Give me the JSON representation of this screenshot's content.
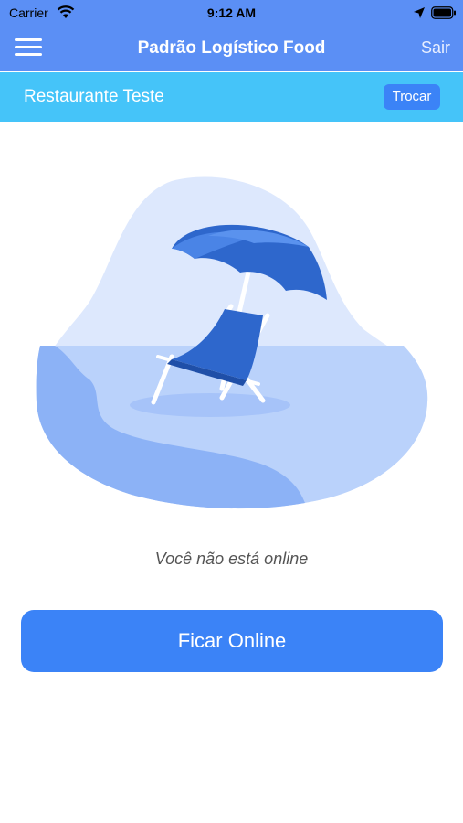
{
  "status_bar": {
    "carrier": "Carrier",
    "time": "9:12 AM"
  },
  "nav": {
    "title": "Padrão Logístico Food",
    "logout_label": "Sair"
  },
  "restaurant": {
    "name": "Restaurante Teste",
    "switch_label": "Trocar"
  },
  "main": {
    "status_message": "Você não está online",
    "go_online_label": "Ficar Online"
  },
  "colors": {
    "nav_blue": "#5b8ff5",
    "restaurant_bar": "#45c4f9",
    "button_blue": "#3b83f7"
  }
}
